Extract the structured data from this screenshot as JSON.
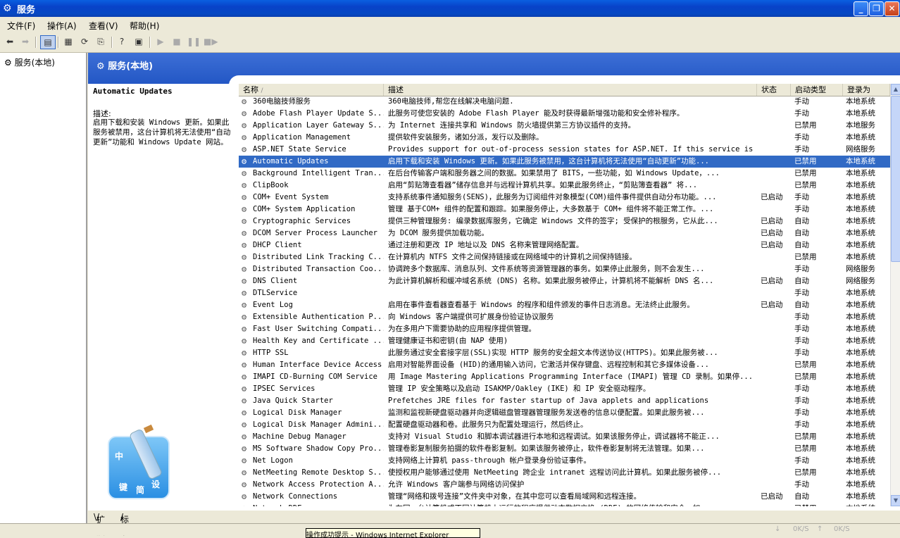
{
  "window": {
    "title": "服务"
  },
  "menu": [
    "文件(F)",
    "操作(A)",
    "查看(V)",
    "帮助(H)"
  ],
  "tree": {
    "root": "服务(本地)"
  },
  "panel": {
    "title": "服务(本地)"
  },
  "description": {
    "service": "Automatic Updates",
    "label": "描述:",
    "text": "启用下载和安装 Windows 更新。如果此服务被禁用，这台计算机将无法使用“自动更新”功能和 Windows Update 网站。"
  },
  "logo": {
    "chars": [
      "中",
      "键",
      "简",
      "设"
    ]
  },
  "columns": [
    "名称",
    "描述",
    "状态",
    "启动类型",
    "登录为"
  ],
  "rows": [
    {
      "name": "360电脑技师服务",
      "desc": "360电脑技师,帮您在线解决电脑问题.",
      "status": "",
      "start": "手动",
      "logon": "本地系统"
    },
    {
      "name": "Adobe Flash Player Update S...",
      "desc": "此服务可使您安装的 Adobe Flash Player 能及时获得最新增强功能和安全修补程序。",
      "status": "",
      "start": "手动",
      "logon": "本地系统"
    },
    {
      "name": "Application Layer Gateway S...",
      "desc": "为 Internet 连接共享和 Windows 防火墙提供第三方协议插件的支持。",
      "status": "",
      "start": "已禁用",
      "logon": "本地服务"
    },
    {
      "name": "Application Management",
      "desc": "提供软件安装服务，诸如分派，发行以及删除。",
      "status": "",
      "start": "手动",
      "logon": "本地系统"
    },
    {
      "name": "ASP.NET State Service",
      "desc": "Provides support for out-of-process session states for ASP.NET. If this service is ...",
      "status": "",
      "start": "手动",
      "logon": "网络服务"
    },
    {
      "name": "Automatic Updates",
      "desc": "启用下载和安装 Windows 更新。如果此服务被禁用，这台计算机将无法使用“自动更新”功能...",
      "status": "",
      "start": "已禁用",
      "logon": "本地系统"
    },
    {
      "name": "Background Intelligent Tran...",
      "desc": "在后台传输客户端和服务器之间的数据。如果禁用了 BITS，一些功能，如 Windows Update，...",
      "status": "",
      "start": "已禁用",
      "logon": "本地系统"
    },
    {
      "name": "ClipBook",
      "desc": "启用“剪贴簿查看器”储存信息并与远程计算机共享。如果此服务终止，“剪贴簿查看器” 将...",
      "status": "",
      "start": "已禁用",
      "logon": "本地系统"
    },
    {
      "name": "COM+ Event System",
      "desc": "支持系统事件通知服务(SENS)，此服务为订阅组件对象模型(COM)组件事件提供自动分布功能。...",
      "status": "已启动",
      "start": "手动",
      "logon": "本地系统"
    },
    {
      "name": "COM+ System Application",
      "desc": "管理 基于COM+ 组件的配置和跟踪。如果服务停止，大多数基于 COM+ 组件将不能正常工作。...",
      "status": "",
      "start": "手动",
      "logon": "本地系统"
    },
    {
      "name": "Cryptographic Services",
      "desc": "提供三种管理服务: 编录数据库服务，它确定 Windows 文件的签字; 受保护的根服务，它从此...",
      "status": "已启动",
      "start": "自动",
      "logon": "本地系统"
    },
    {
      "name": "DCOM Server Process Launcher",
      "desc": "为 DCOM 服务提供加载功能。",
      "status": "已启动",
      "start": "自动",
      "logon": "本地系统"
    },
    {
      "name": "DHCP Client",
      "desc": "通过注册和更改 IP 地址以及 DNS 名称来管理网络配置。",
      "status": "已启动",
      "start": "自动",
      "logon": "本地系统"
    },
    {
      "name": "Distributed Link Tracking C...",
      "desc": "在计算机内 NTFS 文件之间保持链接或在网络域中的计算机之间保持链接。",
      "status": "",
      "start": "已禁用",
      "logon": "本地系统"
    },
    {
      "name": "Distributed Transaction Coo...",
      "desc": "协调跨多个数据库、消息队列、文件系统等资源管理器的事务。如果停止此服务，则不会发生...",
      "status": "",
      "start": "手动",
      "logon": "网络服务"
    },
    {
      "name": "DNS Client",
      "desc": "为此计算机解析和缓冲域名系统 (DNS) 名称。如果此服务被停止，计算机将不能解析 DNS 名...",
      "status": "已启动",
      "start": "自动",
      "logon": "网络服务"
    },
    {
      "name": "DTLService",
      "desc": "",
      "status": "",
      "start": "手动",
      "logon": "本地系统"
    },
    {
      "name": "Event Log",
      "desc": "启用在事件查看器查看基于 Windows 的程序和组件颁发的事件日志消息。无法终止此服务。",
      "status": "已启动",
      "start": "自动",
      "logon": "本地系统"
    },
    {
      "name": "Extensible Authentication P...",
      "desc": "向 Windows 客户端提供可扩展身份验证协议服务",
      "status": "",
      "start": "手动",
      "logon": "本地系统"
    },
    {
      "name": "Fast User Switching Compati...",
      "desc": "为在多用户下需要协助的应用程序提供管理。",
      "status": "",
      "start": "手动",
      "logon": "本地系统"
    },
    {
      "name": "Health Key and Certificate ...",
      "desc": "管理健康证书和密钥(由 NAP 使用)",
      "status": "",
      "start": "手动",
      "logon": "本地系统"
    },
    {
      "name": "HTTP SSL",
      "desc": "此服务通过安全套接字层(SSL)实现 HTTP 服务的安全超文本传送协议(HTTPS)。如果此服务被...",
      "status": "",
      "start": "手动",
      "logon": "本地系统"
    },
    {
      "name": "Human Interface Device Access",
      "desc": "启用对智能界面设备 (HID)的通用输入访问，它激活并保存键盘、远程控制和其它多媒体设备...",
      "status": "",
      "start": "已禁用",
      "logon": "本地系统"
    },
    {
      "name": "IMAPI CD-Burning COM Service",
      "desc": "用 Image Mastering Applications Programming Interface (IMAPI) 管理 CD 录制。如果停...",
      "status": "",
      "start": "已禁用",
      "logon": "本地系统"
    },
    {
      "name": "IPSEC Services",
      "desc": "管理 IP 安全策略以及启动 ISAKMP/Oakley (IKE) 和 IP 安全驱动程序。",
      "status": "",
      "start": "手动",
      "logon": "本地系统"
    },
    {
      "name": "Java Quick Starter",
      "desc": "Prefetches JRE files for faster startup of Java applets and applications",
      "status": "",
      "start": "手动",
      "logon": "本地系统"
    },
    {
      "name": "Logical Disk Manager",
      "desc": "监测和监视新硬盘驱动器并向逻辑磁盘管理器管理服务发送卷的信息以便配置。如果此服务被...",
      "status": "",
      "start": "手动",
      "logon": "本地系统"
    },
    {
      "name": "Logical Disk Manager Admini...",
      "desc": "配置硬盘驱动器和卷。此服务只为配置处理运行，然后终止。",
      "status": "",
      "start": "手动",
      "logon": "本地系统"
    },
    {
      "name": "Machine Debug Manager",
      "desc": "支持对 Visual Studio 和脚本调试器进行本地和远程调试。如果该服务停止，调试器将不能正...",
      "status": "",
      "start": "已禁用",
      "logon": "本地系统"
    },
    {
      "name": "MS Software Shadow Copy Pro...",
      "desc": "管理卷影复制服务拍摄的软件卷影复制。如果该服务被停止，软件卷影复制将无法管理。如果...",
      "status": "",
      "start": "已禁用",
      "logon": "本地系统"
    },
    {
      "name": "Net Logon",
      "desc": "支持网络上计算机 pass-through 帐户登录身份验证事件。",
      "status": "",
      "start": "手动",
      "logon": "本地系统"
    },
    {
      "name": "NetMeeting Remote Desktop S...",
      "desc": "使授权用户能够通过使用 NetMeeting 跨企业 intranet 远程访问此计算机。如果此服务被停...",
      "status": "",
      "start": "已禁用",
      "logon": "本地系统"
    },
    {
      "name": "Network Access Protection A...",
      "desc": "允许 Windows 客户端参与网络访问保护",
      "status": "",
      "start": "手动",
      "logon": "本地系统"
    },
    {
      "name": "Network Connections",
      "desc": "管理“网络和拨号连接”文件夹中对象，在其中您可以查看局域网和远程连接。",
      "status": "已启动",
      "start": "自动",
      "logon": "本地系统"
    },
    {
      "name": "Network DDE",
      "desc": "为在同一台计算机或不同计算机上运行的程序提供动态数据交换 (DDE) 的网络传输和安全。如...",
      "status": "",
      "start": "已禁用",
      "logon": "本地系统"
    }
  ],
  "tabs": [
    "扩展",
    "标准"
  ],
  "status": {
    "tooltip": "操作成功提示 - Windows Internet Explorer",
    "net1": "0K/S",
    "net2": "0K/S"
  }
}
